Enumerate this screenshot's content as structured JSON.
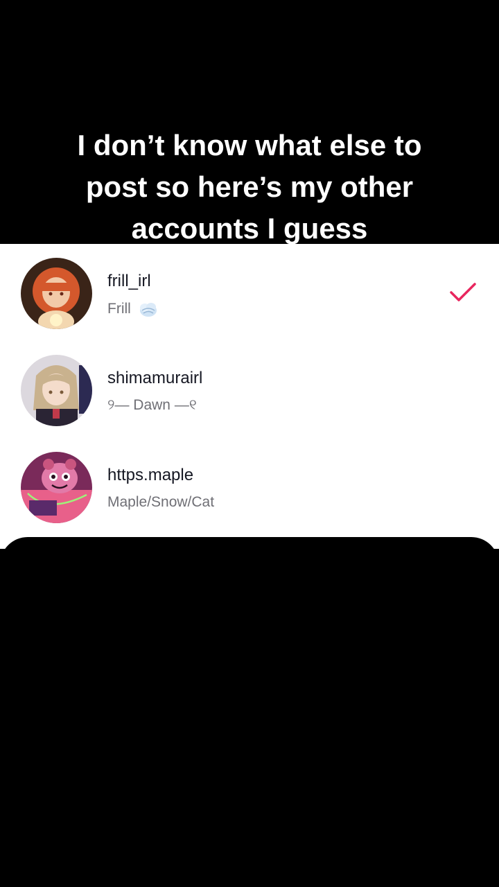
{
  "caption": {
    "line1": "I don’t know what else to",
    "line2": "post so here’s my other",
    "line3": "accounts I guess"
  },
  "accounts": [
    {
      "username": "frill_irl",
      "display_name": "Frill",
      "badge_icon": "cloud-icon",
      "selected": true,
      "avatar_icon": "anime-girl-orange-hair-avatar"
    },
    {
      "username": "shimamurairl",
      "display_name": "୨— Dawn —୧",
      "selected": false,
      "avatar_icon": "anime-girl-blonde-hair-avatar"
    },
    {
      "username": "https.maple",
      "display_name": "Maple/Snow/Cat",
      "selected": false,
      "avatar_icon": "pink-character-avatar"
    }
  ],
  "colors": {
    "check": "#e8265e",
    "username": "#161823",
    "secondary": "#6f6f75",
    "sheet": "#ffffff",
    "background": "#000000"
  }
}
